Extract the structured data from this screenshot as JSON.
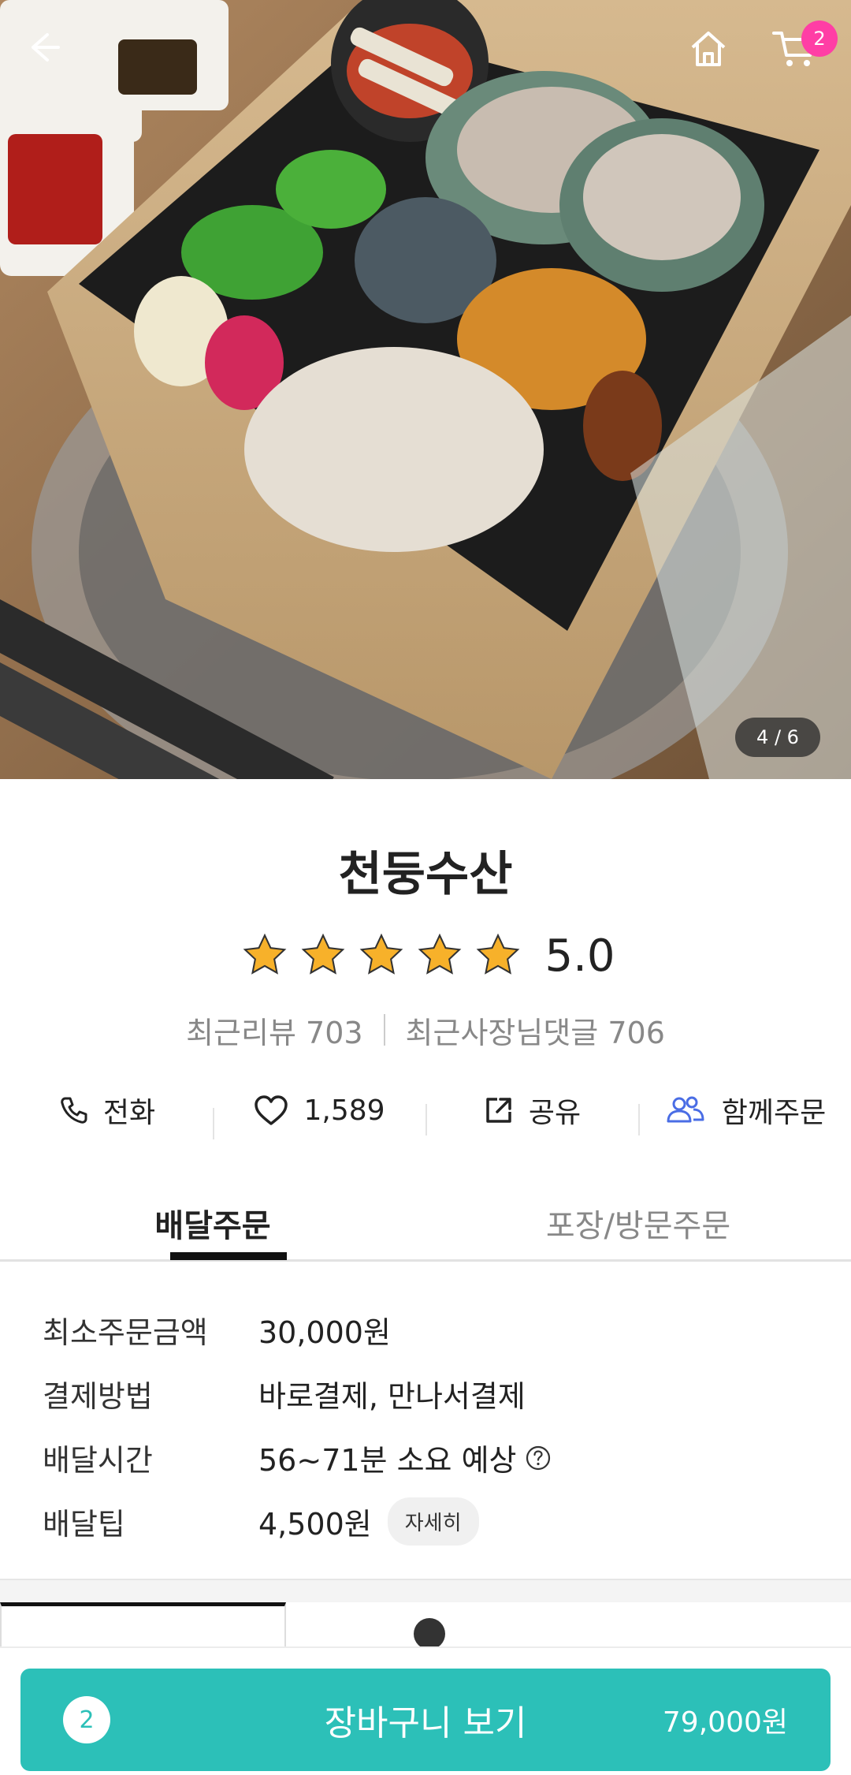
{
  "hero": {
    "image_counter": "4 / 6",
    "cart_badge_count": "2",
    "icons": [
      "back-arrow-icon",
      "home-icon",
      "cart-icon"
    ]
  },
  "store": {
    "name": "천둥수산",
    "rating_value": "5.0",
    "stars": 5,
    "recent_reviews": "최근리뷰 703",
    "owner_replies": "최근사장님댓글 706"
  },
  "actions": {
    "call": "전화",
    "likes": "1,589",
    "share": "공유",
    "group_order": "함께주문"
  },
  "order_tabs": {
    "delivery": "배달주문",
    "pickup": "포장/방문주문"
  },
  "info": {
    "min_order_label": "최소주문금액",
    "min_order_value": "30,000원",
    "payment_label": "결제방법",
    "payment_value": "바로결제, 만나서결제",
    "delivery_time_label": "배달시간",
    "delivery_time_value": "56~71분 소요 예상",
    "delivery_tip_label": "배달팁",
    "delivery_tip_value": "4,500원",
    "detail_button": "자세히"
  },
  "cart_bar": {
    "count": "2",
    "label": "장바구니 보기",
    "price": "79,000원"
  },
  "colors": {
    "accent": "#2cc0b8",
    "badge": "#ff3ea5",
    "star": "#f7b12a",
    "group_order_icon": "#4a6de5"
  }
}
